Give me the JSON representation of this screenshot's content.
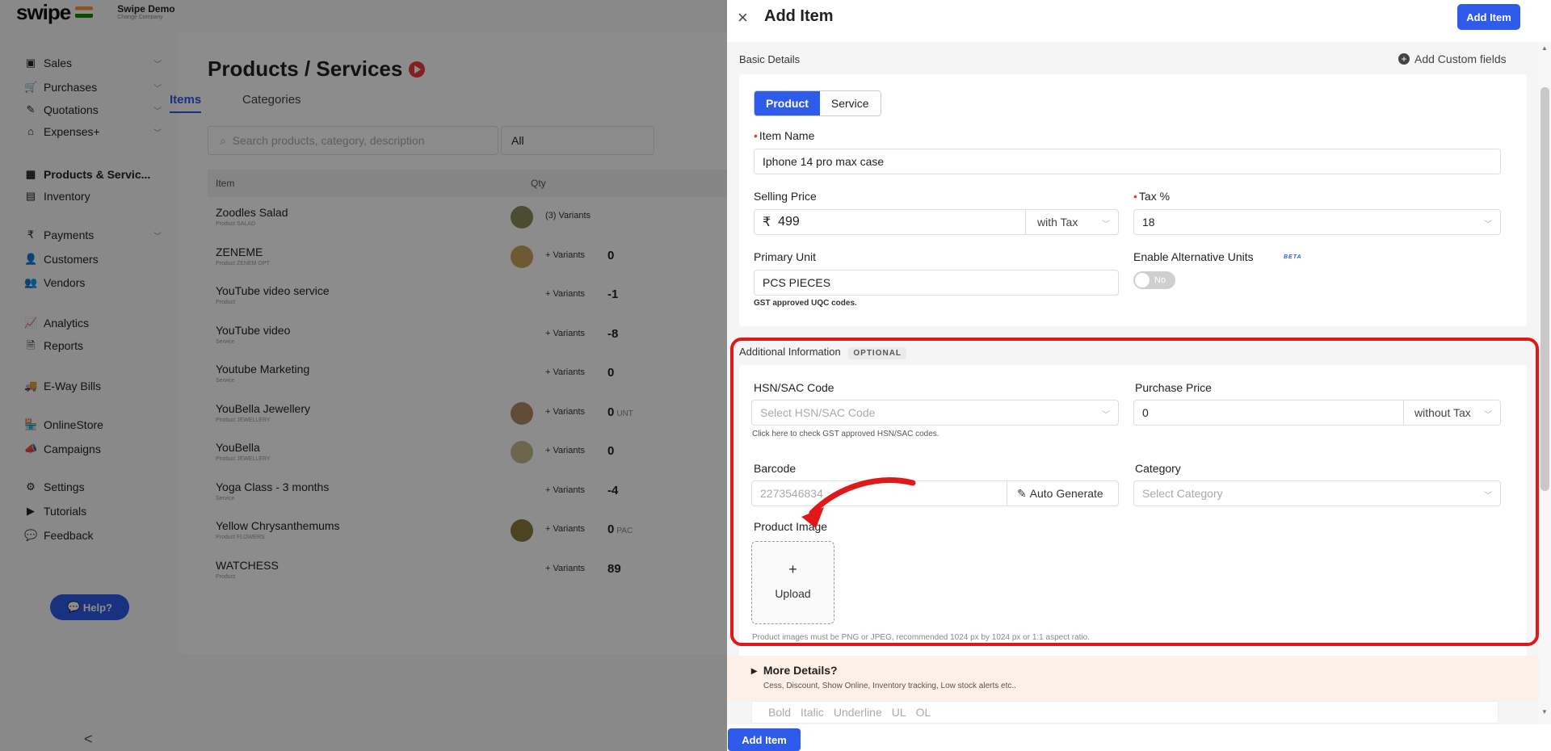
{
  "app": {
    "logo": "swipe",
    "company_name": "Swipe Demo",
    "company_sub": "Change Company"
  },
  "sidebar": {
    "items": [
      {
        "label": "Sales",
        "icon": "sales-icon",
        "glyph": "▣",
        "chevron": true
      },
      {
        "label": "Purchases",
        "icon": "cart-icon",
        "glyph": "🛒",
        "chevron": true
      },
      {
        "label": "Quotations",
        "icon": "pen-icon",
        "glyph": "✎",
        "chevron": true
      },
      {
        "label": "Expenses+",
        "icon": "tag-icon",
        "glyph": "⌂",
        "chevron": true
      },
      {
        "label": "Products & Servic...",
        "icon": "products-icon",
        "glyph": "▦",
        "chevron": false,
        "active": true
      },
      {
        "label": "Inventory",
        "icon": "inventory-icon",
        "glyph": "▤",
        "chevron": false
      },
      {
        "label": "Payments",
        "icon": "rupee-icon",
        "glyph": "₹",
        "chevron": true
      },
      {
        "label": "Customers",
        "icon": "user-icon",
        "glyph": "👤",
        "chevron": false
      },
      {
        "label": "Vendors",
        "icon": "users-icon",
        "glyph": "👥",
        "chevron": false
      },
      {
        "label": "Analytics",
        "icon": "chart-icon",
        "glyph": "📈",
        "chevron": false
      },
      {
        "label": "Reports",
        "icon": "report-icon",
        "glyph": "🗎",
        "chevron": false
      },
      {
        "label": "E-Way Bills",
        "icon": "truck-icon",
        "glyph": "🚚",
        "chevron": false
      },
      {
        "label": "OnlineStore",
        "icon": "store-icon",
        "glyph": "🏪",
        "chevron": false
      },
      {
        "label": "Campaigns",
        "icon": "megaphone-icon",
        "glyph": "📣",
        "chevron": false
      },
      {
        "label": "Settings",
        "icon": "gear-icon",
        "glyph": "⚙",
        "chevron": false
      },
      {
        "label": "Tutorials",
        "icon": "youtube-icon",
        "glyph": "▶",
        "chevron": false
      },
      {
        "label": "Feedback",
        "icon": "chat-icon",
        "glyph": "💬",
        "chevron": false
      }
    ],
    "help_label": "Help?",
    "collapse_glyph": "<"
  },
  "products": {
    "title": "Products / Services",
    "tabs": [
      "Items",
      "Categories"
    ],
    "search_placeholder": "Search products, category, description",
    "filter_value": "All",
    "columns": [
      "Item",
      "Qty"
    ],
    "rows": [
      {
        "name": "Zoodles Salad",
        "sub": "Product SALAD",
        "variant": "(3) Variants",
        "qty": ""
      },
      {
        "name": "ZENEME",
        "sub": "Product ZENEM OPT",
        "variant": "+ Variants",
        "qty": "0"
      },
      {
        "name": "YouTube video service",
        "sub": "Product",
        "variant": "+ Variants",
        "qty": "-1"
      },
      {
        "name": "YouTube video",
        "sub": "Service",
        "variant": "+ Variants",
        "qty": "-8"
      },
      {
        "name": "Youtube Marketing",
        "sub": "Service",
        "variant": "+ Variants",
        "qty": "0"
      },
      {
        "name": "YouBella Jewellery",
        "sub": "Product JEWELLERY",
        "variant": "+ Variants",
        "qty": "0",
        "unit": "UNT"
      },
      {
        "name": "YouBella",
        "sub": "Product JEWELLERY",
        "variant": "+ Variants",
        "qty": "0"
      },
      {
        "name": "Yoga Class - 3 months",
        "sub": "Service",
        "variant": "+ Variants",
        "qty": "-4"
      },
      {
        "name": "Yellow Chrysanthemums",
        "sub": "Product FLOWERS",
        "variant": "+ Variants",
        "qty": "0",
        "unit": "PAC"
      },
      {
        "name": "WATCHESS",
        "sub": "Product",
        "variant": "+ Variants",
        "qty": "89"
      }
    ]
  },
  "drawer": {
    "close_glyph": "×",
    "title": "Add Item",
    "save_label": "Add Item",
    "basic_title": "Basic Details",
    "custom_fields": "Add Custom fields",
    "types": [
      "Product",
      "Service"
    ],
    "item_name_label": "Item Name",
    "item_name_value": "Iphone 14 pro max case",
    "selling_price_label": "Selling Price",
    "currency": "₹",
    "selling_price_value": "499",
    "price_tax_mode": "with Tax",
    "tax_label": "Tax %",
    "tax_value": "18",
    "unit_label": "Primary Unit",
    "unit_value": "PCS PIECES",
    "unit_hint": "GST approved UQC codes.",
    "alt_units_label": "Enable Alternative Units",
    "beta": "BETA",
    "alt_units_toggle": "No",
    "additional_title": "Additional Information",
    "optional": "OPTIONAL",
    "hsn_label": "HSN/SAC Code",
    "hsn_placeholder": "Select HSN/SAC Code",
    "hsn_hint": "Click here to check GST approved HSN/SAC codes.",
    "purchase_label": "Purchase Price",
    "purchase_value": "0",
    "purchase_tax_mode": "without Tax",
    "barcode_label": "Barcode",
    "barcode_value": "2273546834",
    "auto_generate": "Auto Generate",
    "category_label": "Category",
    "category_placeholder": "Select Category",
    "image_label": "Product Image",
    "upload_plus": "+",
    "upload_label": "Upload",
    "image_hint": "Product images must be PNG or JPEG, recommended 1024 px by 1024 px or 1:1 aspect ratio.",
    "more_title": "More Details?",
    "more_sub": "Cess, Discount, Show Online, Inventory tracking, Low stock alerts etc..",
    "rte_tools": [
      "Bold",
      "Italic",
      "Underline",
      "UL",
      "OL"
    ],
    "bottom_save": "Add Item"
  },
  "colors": {
    "brand": "#2f5bea",
    "highlight": "#e01818",
    "required": "#e53935"
  }
}
